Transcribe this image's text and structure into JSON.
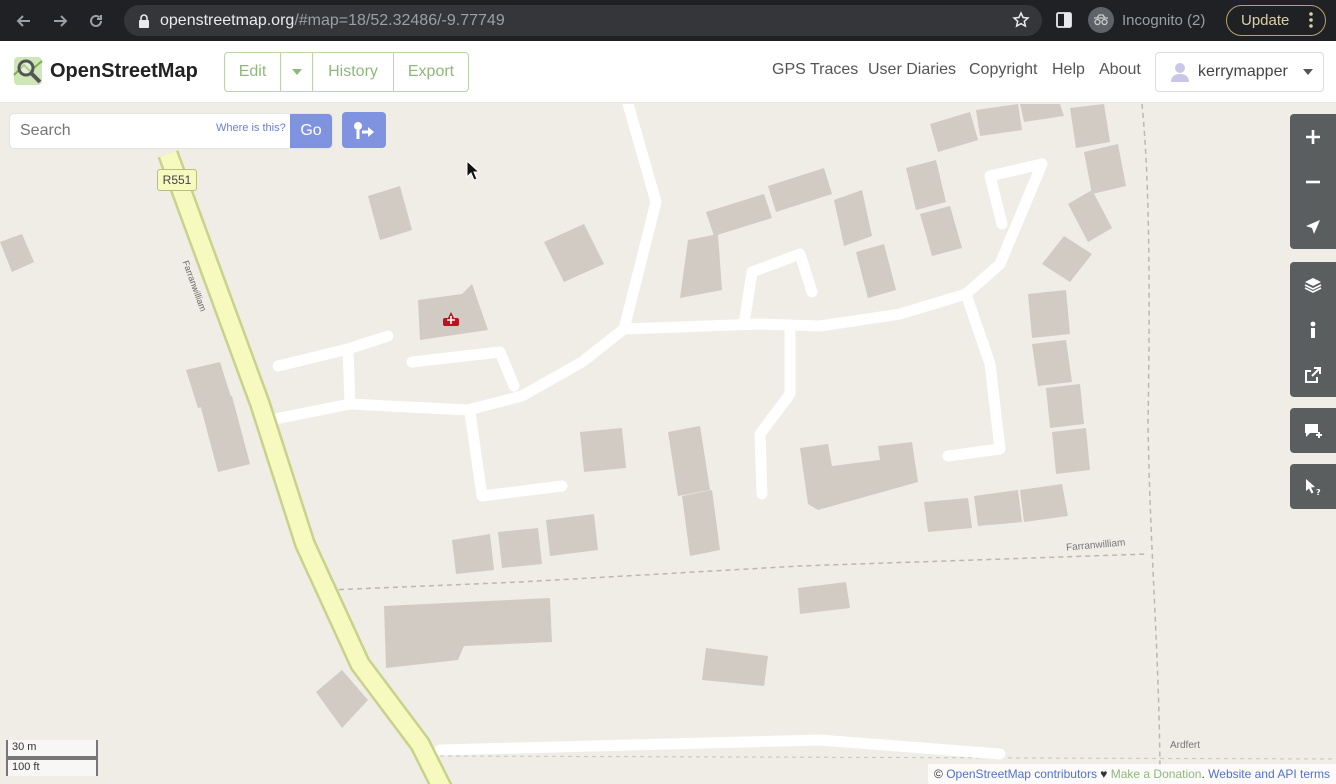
{
  "browser": {
    "url_domain": "openstreetmap.org",
    "url_path": "/#map=18/52.32486/-9.77749",
    "incognito_label": "Incognito (2)",
    "update_label": "Update"
  },
  "header": {
    "brand": "OpenStreetMap",
    "edit_label": "Edit",
    "history_label": "History",
    "export_label": "Export",
    "nav_links": [
      "GPS Traces",
      "User Diaries",
      "Copyright",
      "Help",
      "About"
    ],
    "username": "kerrymapper"
  },
  "search": {
    "placeholder": "Search",
    "where_is_this": "Where is this?",
    "go_label": "Go"
  },
  "map": {
    "road_ref_label": "R551",
    "road_name_vertical": "Farranwilliam",
    "street_label_1": "Farranwilliam",
    "place_label": "Ardfert",
    "scale_metric": "30 m",
    "scale_imperial": "100 ft"
  },
  "attribution": {
    "prefix": "© ",
    "contributors": "OpenStreetMap contributors",
    "heart": " ♥ ",
    "donation": "Make a Donation",
    "separator": ". ",
    "terms": "Website and API terms"
  },
  "colors": {
    "map_bg": "#f0ece6",
    "building": "#d2cbc4",
    "road_white": "#ffffff",
    "primary_road": "#f7fabf",
    "primary_road_casing": "#c8d28a",
    "osm_green": "#8fb87a",
    "search_blue": "#7f93e0"
  }
}
